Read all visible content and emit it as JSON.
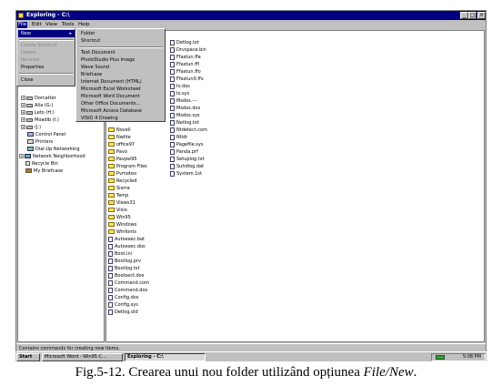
{
  "window": {
    "title": "Exploring - C:\\",
    "controls": {
      "minimize": "_",
      "maximize": "□",
      "close": "×"
    }
  },
  "menubar": {
    "items": [
      "File",
      "Edit",
      "View",
      "Tools",
      "Help"
    ]
  },
  "file_menu": {
    "items": [
      {
        "label": "New",
        "state": "highlighted",
        "submenu": true
      },
      {
        "label": "Create Shortcut",
        "state": "disabled"
      },
      {
        "label": "Delete",
        "state": "disabled"
      },
      {
        "label": "Rename",
        "state": "disabled"
      },
      {
        "label": "Properties",
        "state": "normal"
      },
      {
        "label": "Close",
        "state": "normal"
      }
    ]
  },
  "new_submenu": {
    "items": [
      "Folder",
      "Shortcut",
      "Text Document",
      "PhotoStudio Plus Image",
      "Wave Sound",
      "Briefcase",
      "Internet Document (HTML)",
      "Microsoft Excel Worksheet",
      "Microsoft Word Document",
      "Other Office Documents...",
      "Microsoft Access Database",
      "VISIO 4 Drawing"
    ]
  },
  "tree": {
    "items": [
      {
        "label": "Dorcatter",
        "icon": "drive-icon",
        "toggle": "+"
      },
      {
        "label": "Alia (G:)",
        "icon": "drive-icon",
        "toggle": "+"
      },
      {
        "label": "Leto (H:)",
        "icon": "drive-icon",
        "toggle": "+"
      },
      {
        "label": "Moadib (I:)",
        "icon": "drive-icon",
        "toggle": "+"
      },
      {
        "label": "(J:)",
        "icon": "drive-icon",
        "toggle": "+"
      },
      {
        "label": "Control Panel",
        "icon": "control-panel-icon",
        "toggle": ""
      },
      {
        "label": "Printers",
        "icon": "printer-icon",
        "toggle": ""
      },
      {
        "label": "Dial-Up Networking",
        "icon": "dialup-icon",
        "toggle": ""
      },
      {
        "label": "Network Neighborhood",
        "icon": "network-icon",
        "toggle": "+"
      },
      {
        "label": "Recycle Bin",
        "icon": "recycle-bin-icon",
        "toggle": ""
      },
      {
        "label": "My Briefcase",
        "icon": "briefcase-icon",
        "toggle": ""
      }
    ]
  },
  "list": {
    "column1": [
      {
        "name": "Novell",
        "type": "folder"
      },
      {
        "name": "Nwlite",
        "type": "folder"
      },
      {
        "name": "office97",
        "type": "folder"
      },
      {
        "name": "Pavo",
        "type": "folder"
      },
      {
        "name": "Pavpw95",
        "type": "folder"
      },
      {
        "name": "Program Files",
        "type": "folder"
      },
      {
        "name": "Pvmoteo",
        "type": "folder"
      },
      {
        "name": "Recycled",
        "type": "folder"
      },
      {
        "name": "Sierra",
        "type": "folder"
      },
      {
        "name": "Temp",
        "type": "folder"
      },
      {
        "name": "Views31",
        "type": "folder"
      },
      {
        "name": "Visio",
        "type": "folder"
      },
      {
        "name": "Win95",
        "type": "folder"
      },
      {
        "name": "Windows",
        "type": "folder"
      },
      {
        "name": "Winfonts",
        "type": "folder"
      },
      {
        "name": "Autoexec.bat",
        "type": "file"
      },
      {
        "name": "Autoexec.dos",
        "type": "file"
      },
      {
        "name": "Boot.ini",
        "type": "file"
      },
      {
        "name": "Bootlog.prv",
        "type": "file"
      },
      {
        "name": "Bootlog.txt",
        "type": "file"
      },
      {
        "name": "Bootsect.dos",
        "type": "file"
      },
      {
        "name": "Command.com",
        "type": "file"
      },
      {
        "name": "Command.dos",
        "type": "file"
      },
      {
        "name": "Config.dos",
        "type": "file"
      },
      {
        "name": "Config.sys",
        "type": "file"
      },
      {
        "name": "Detlog.old",
        "type": "file"
      }
    ],
    "column2": [
      {
        "name": "Detlog.txt",
        "type": "file"
      },
      {
        "name": "Drvspace.bin",
        "type": "file"
      },
      {
        "name": "Ffastun.ffa",
        "type": "file"
      },
      {
        "name": "Ffastun.ffl",
        "type": "file"
      },
      {
        "name": "Ffastun.ffo",
        "type": "file"
      },
      {
        "name": "Ffastun0.ffx",
        "type": "file"
      },
      {
        "name": "Io.dos",
        "type": "file"
      },
      {
        "name": "Io.sys",
        "type": "file"
      },
      {
        "name": "Msdos.---",
        "type": "file"
      },
      {
        "name": "Msdos.dos",
        "type": "file"
      },
      {
        "name": "Msdos.sys",
        "type": "file"
      },
      {
        "name": "Netlog.txt",
        "type": "file"
      },
      {
        "name": "Ntdetect.com",
        "type": "file"
      },
      {
        "name": "Ntldr",
        "type": "file"
      },
      {
        "name": "Pagefile.sys",
        "type": "file"
      },
      {
        "name": "Panda.prf",
        "type": "file"
      },
      {
        "name": "Setuplog.txt",
        "type": "file"
      },
      {
        "name": "Suhdlog.dat",
        "type": "file"
      },
      {
        "name": "System.1st",
        "type": "file"
      }
    ]
  },
  "status_bar": {
    "text": "Contains commands for creating new items."
  },
  "taskbar": {
    "start_label": "Start",
    "buttons": [
      "Microsoft Word - Win95 C...",
      "Exploring - C:\\"
    ],
    "clock": "5:08 PM"
  },
  "caption": {
    "prefix": "Fig.5-12. Crearea unui nou folder utilizând opțiunea ",
    "menu_path": "File/New",
    "suffix": "."
  }
}
